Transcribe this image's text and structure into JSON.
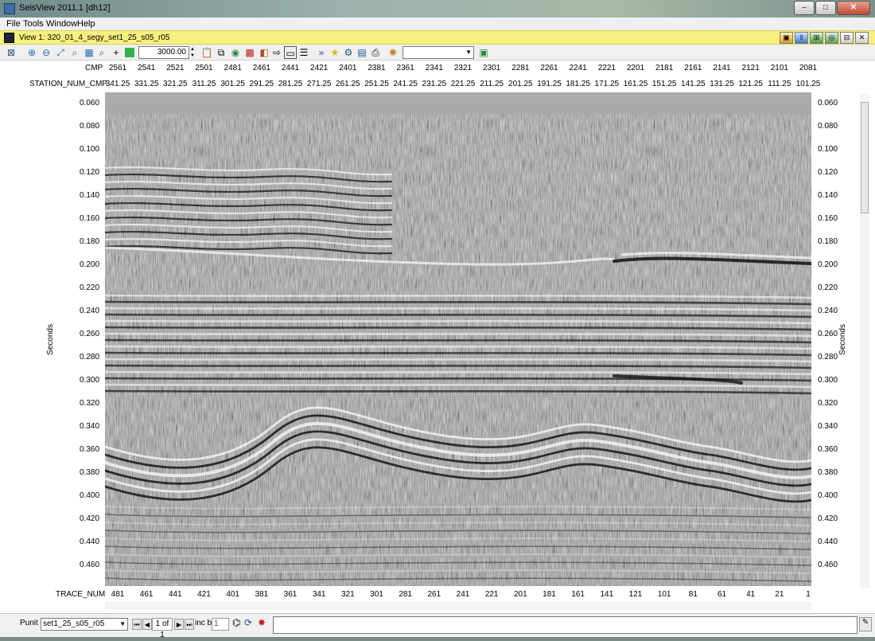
{
  "window": {
    "title": "SeisView 2011.1 [dh12]",
    "minimize": "–",
    "maximize": "□",
    "close": "✕"
  },
  "menu": [
    "File",
    "Tools",
    "Window",
    "Help"
  ],
  "view": {
    "title": "View 1: 320_01_4_segy_set1_25_s05_r05",
    "right_icons": [
      "layer-icon",
      "export-icon",
      "grid-icon",
      "map-icon",
      "tile-icon",
      "close-icon"
    ]
  },
  "toolbar": {
    "zoom_value": "3000.00",
    "combo_value": ""
  },
  "axes": {
    "cmp_label": "CMP",
    "cmp_ticks": [
      "2561",
      "2541",
      "2521",
      "2501",
      "2481",
      "2461",
      "2441",
      "2421",
      "2401",
      "2381",
      "2361",
      "2341",
      "2321",
      "2301",
      "2281",
      "2261",
      "2241",
      "2221",
      "2201",
      "2181",
      "2161",
      "2141",
      "2121",
      "2101",
      "2081"
    ],
    "station_label": "STATION_NUM_CMP",
    "station_ticks": [
      "341.25",
      "331.25",
      "321.25",
      "311.25",
      "301.25",
      "291.25",
      "281.25",
      "271.25",
      "261.25",
      "251.25",
      "241.25",
      "231.25",
      "221.25",
      "211.25",
      "201.25",
      "191.25",
      "181.25",
      "171.25",
      "161.25",
      "151.25",
      "141.25",
      "131.25",
      "121.25",
      "111.25",
      "101.25"
    ],
    "trace_label": "TRACE_NUM",
    "trace_ticks": [
      "481",
      "461",
      "441",
      "421",
      "401",
      "381",
      "361",
      "341",
      "321",
      "301",
      "281",
      "261",
      "241",
      "221",
      "201",
      "181",
      "161",
      "141",
      "121",
      "101",
      "81",
      "61",
      "41",
      "21",
      "1"
    ],
    "time_ticks": [
      "0.060",
      "0.080",
      "0.100",
      "0.120",
      "0.140",
      "0.160",
      "0.180",
      "0.200",
      "0.220",
      "0.240",
      "0.260",
      "0.280",
      "0.300",
      "0.320",
      "0.340",
      "0.360",
      "0.380",
      "0.400",
      "0.420",
      "0.440",
      "0.460"
    ],
    "y_title_left": "Seconds",
    "y_title_right": "Seconds"
  },
  "status": {
    "punit_label": "Punit",
    "punit_value": "set1_25_s05_r05",
    "page_value": "1 of 1",
    "inc_label": "inc by",
    "inc_value": "1",
    "command_text": ""
  }
}
